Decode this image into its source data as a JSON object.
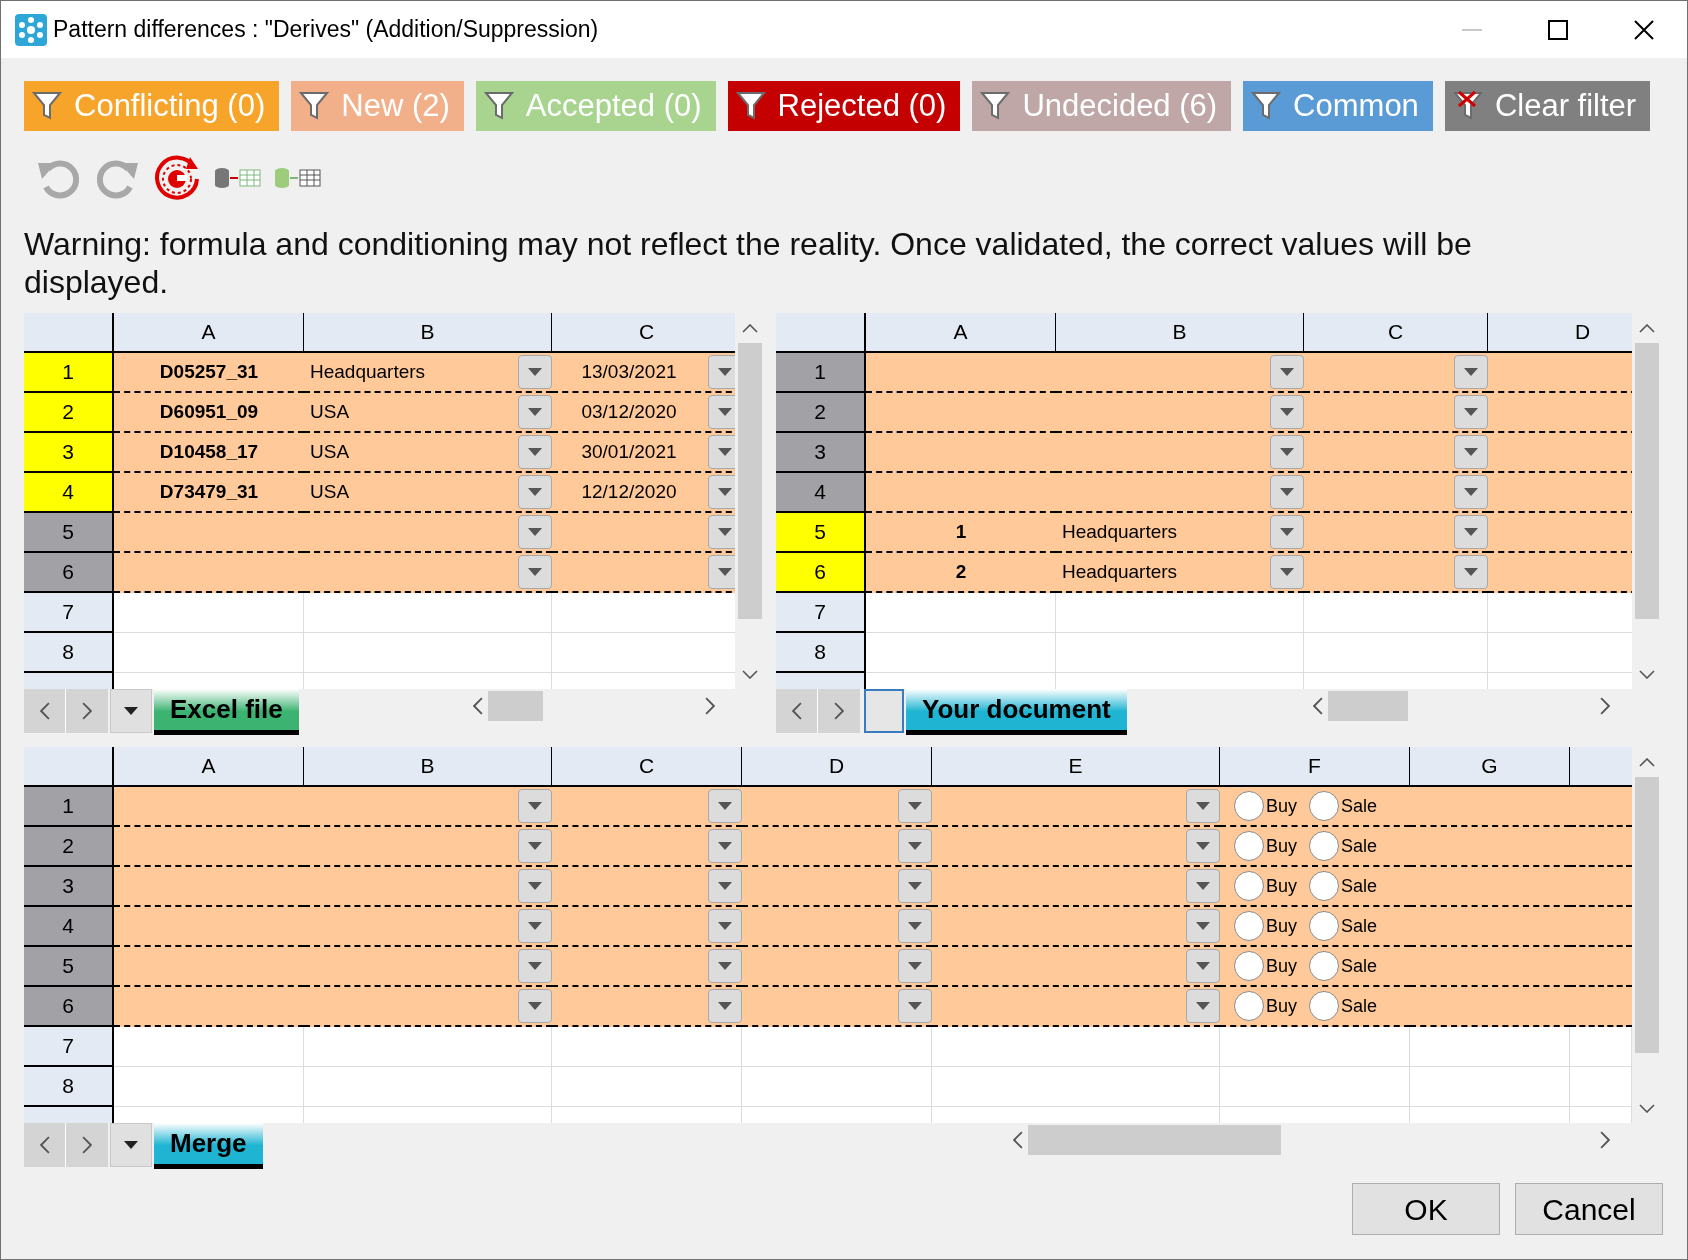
{
  "window": {
    "title": "Pattern differences : \"Derives\" (Addition/Suppression)"
  },
  "filters": [
    {
      "label": "Conflicting (0)",
      "kind": "filter",
      "color": "#f7a42a"
    },
    {
      "label": "New (2)",
      "kind": "filter",
      "color": "#f2b08a"
    },
    {
      "label": "Accepted (0)",
      "kind": "filter",
      "color": "#a8d48f"
    },
    {
      "label": "Rejected (0)",
      "kind": "filter",
      "color": "#c40000"
    },
    {
      "label": "Undecided (6)",
      "kind": "filter",
      "color": "#bea7a6"
    },
    {
      "label": "Common",
      "kind": "filter",
      "color": "#5b9bd5"
    },
    {
      "label": "Clear filter",
      "kind": "clear",
      "color": "#808080"
    }
  ],
  "warning": "Warning: formula and conditioning may not reflect the reality. Once validated, the correct values will be displayed.",
  "grids": [
    {
      "columns": [
        {
          "label": "A",
          "kind": "key"
        },
        {
          "label": "B",
          "kind": "choice"
        },
        {
          "label": "C",
          "kind": "date"
        }
      ],
      "rows": [
        {
          "number": "1",
          "kind": "changed",
          "cells": {
            "A": "D05257_31",
            "B": "Headquarters",
            "C": "13/03/2021"
          }
        },
        {
          "number": "2",
          "kind": "changed",
          "cells": {
            "A": "D60951_09",
            "B": "USA",
            "C": "03/12/2020"
          }
        },
        {
          "number": "3",
          "kind": "changed",
          "cells": {
            "A": "D10458_17",
            "B": "USA",
            "C": "30/01/2021"
          }
        },
        {
          "number": "4",
          "kind": "changed",
          "cells": {
            "A": "D73479_31",
            "B": "USA",
            "C": "12/12/2020"
          }
        },
        {
          "number": "5",
          "kind": "unchanged"
        },
        {
          "number": "6",
          "kind": "unchanged"
        },
        {
          "number": "7",
          "kind": "empty"
        },
        {
          "number": "8",
          "kind": "empty"
        }
      ],
      "sheet_tab": {
        "label": "Excel file",
        "color": "#3cb371",
        "selected": true
      }
    },
    {
      "columns": [
        {
          "label": "A",
          "kind": "key"
        },
        {
          "label": "B",
          "kind": "choice"
        },
        {
          "label": "C",
          "kind": "choice"
        },
        {
          "label": "D",
          "kind": "plain"
        }
      ],
      "rows": [
        {
          "number": "1",
          "kind": "unchanged"
        },
        {
          "number": "2",
          "kind": "unchanged"
        },
        {
          "number": "3",
          "kind": "unchanged"
        },
        {
          "number": "4",
          "kind": "unchanged"
        },
        {
          "number": "5",
          "kind": "changed",
          "cells": {
            "A": "1",
            "B": "Headquarters"
          }
        },
        {
          "number": "6",
          "kind": "changed",
          "cells": {
            "A": "2",
            "B": "Headquarters"
          }
        },
        {
          "number": "7",
          "kind": "empty"
        },
        {
          "number": "8",
          "kind": "empty"
        }
      ],
      "sheet_tab": {
        "label": "Your document",
        "color": "#1eb4d2",
        "selected": true
      }
    },
    {
      "columns": [
        {
          "label": "A",
          "kind": "key"
        },
        {
          "label": "B",
          "kind": "choice"
        },
        {
          "label": "C",
          "kind": "choice"
        },
        {
          "label": "D",
          "kind": "choice"
        },
        {
          "label": "E",
          "kind": "choice"
        },
        {
          "label": "F",
          "kind": "radio"
        },
        {
          "label": "G",
          "kind": "plain"
        }
      ],
      "rows": [
        {
          "number": "1",
          "kind": "unchanged",
          "options": [
            {
              "label": "Buy",
              "selected": false
            },
            {
              "label": "Sale",
              "selected": false
            }
          ]
        },
        {
          "number": "2",
          "kind": "unchanged",
          "options": [
            {
              "label": "Buy",
              "selected": false
            },
            {
              "label": "Sale",
              "selected": false
            }
          ]
        },
        {
          "number": "3",
          "kind": "unchanged",
          "options": [
            {
              "label": "Buy",
              "selected": false
            },
            {
              "label": "Sale",
              "selected": false
            }
          ]
        },
        {
          "number": "4",
          "kind": "unchanged",
          "options": [
            {
              "label": "Buy",
              "selected": false
            },
            {
              "label": "Sale",
              "selected": false
            }
          ]
        },
        {
          "number": "5",
          "kind": "unchanged",
          "options": [
            {
              "label": "Buy",
              "selected": false
            },
            {
              "label": "Sale",
              "selected": false
            }
          ]
        },
        {
          "number": "6",
          "kind": "unchanged",
          "options": [
            {
              "label": "Buy",
              "selected": false
            },
            {
              "label": "Sale",
              "selected": false
            }
          ]
        },
        {
          "number": "7",
          "kind": "empty"
        },
        {
          "number": "8",
          "kind": "empty"
        }
      ],
      "sheet_tab": {
        "label": "Merge",
        "color": "#1eb4d2",
        "selected": true
      }
    }
  ],
  "buttons": [
    "OK",
    "Cancel"
  ]
}
